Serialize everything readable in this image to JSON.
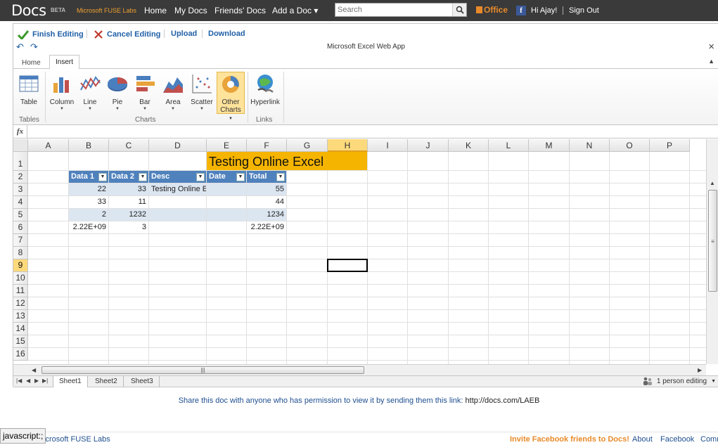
{
  "topbar": {
    "brand": "Docs",
    "beta": "BETA",
    "fuse": "Microsoft FUSE Labs",
    "nav": [
      "Home",
      "My Docs",
      "Friends' Docs",
      "Add a Doc ▾"
    ],
    "search_placeholder": "Search",
    "office": "Office",
    "greeting": "Hi Ajay!",
    "signout": "Sign Out"
  },
  "editbar": {
    "finish": "Finish Editing",
    "cancel": "Cancel Editing",
    "upload": "Upload",
    "download": "Download",
    "app_title": "Microsoft Excel Web App"
  },
  "tabs": [
    "Home",
    "Insert"
  ],
  "ribbon": {
    "buttons": [
      {
        "label": "Table"
      },
      {
        "label": "Column"
      },
      {
        "label": "Line"
      },
      {
        "label": "Pie"
      },
      {
        "label": "Bar"
      },
      {
        "label": "Area"
      },
      {
        "label": "Scatter"
      },
      {
        "label": "Other",
        "label2": "Charts"
      },
      {
        "label": "Hyperlink"
      }
    ],
    "groups": [
      "Tables",
      "Charts",
      "Links"
    ]
  },
  "formula_bar": {
    "fx": "fx",
    "value": ""
  },
  "columns": [
    "A",
    "B",
    "C",
    "D",
    "E",
    "F",
    "G",
    "H",
    "I",
    "J",
    "K",
    "L",
    "M",
    "N",
    "O",
    "P"
  ],
  "rows": [
    "1",
    "2",
    "3",
    "4",
    "5",
    "6",
    "7",
    "8",
    "9",
    "10",
    "11",
    "12",
    "13",
    "14",
    "15",
    "16"
  ],
  "sheet": {
    "title": "Testing Online Excel",
    "headers": [
      "Data 1",
      "Data 2",
      "Desc",
      "Date",
      "Total"
    ],
    "data": [
      [
        "22",
        "33",
        "Testing Online Excel",
        "",
        "55"
      ],
      [
        "33",
        "11",
        "",
        "",
        "44"
      ],
      [
        "2",
        "1232",
        "",
        "",
        "1234"
      ],
      [
        "2.22E+09",
        "3",
        "",
        "",
        "2.22E+09"
      ]
    ]
  },
  "sheet_tabs": [
    "Sheet1",
    "Sheet2",
    "Sheet3"
  ],
  "editing_status": "1 person editing",
  "share": {
    "text": "Share this doc with anyone who has permission to view it by sending them this link:",
    "link": "http://docs.com/LAEB"
  },
  "footer": {
    "left": "icrosoft FUSE Labs",
    "invite": "Invite Facebook friends to Docs!",
    "about": "About",
    "facebook": "Facebook",
    "comm": "Comm"
  },
  "status_text": "javascript:;",
  "colors": {
    "accent": "#4f81bd",
    "title_fill": "#f5b400",
    "band": "#dce6f1"
  }
}
